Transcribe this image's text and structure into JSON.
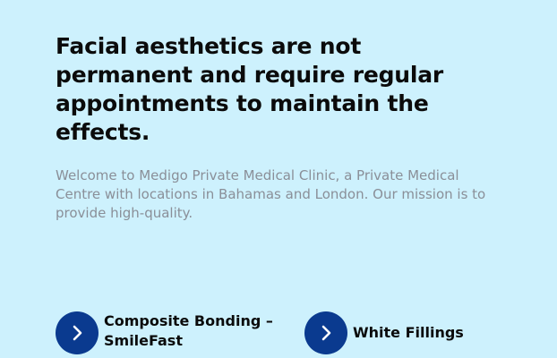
{
  "hero": {
    "headline": "Facial aesthetics are not permanent and require regular appointments to maintain the effects.",
    "intro": "Welcome to Medigo Private Medical Clinic, a Private Medical Centre with locations in Bahamas and London. Our mission is to provide high-quality."
  },
  "services": {
    "items": [
      {
        "label": "Composite Bonding – SmileFast",
        "icon": "chevron-right-icon"
      },
      {
        "label": "White Fillings",
        "icon": "chevron-right-icon"
      }
    ]
  },
  "colors": {
    "background": "#cdf1fd",
    "accent": "#0a3a8f",
    "heading": "#0b0b0b",
    "body_text": "#8a8f98"
  }
}
